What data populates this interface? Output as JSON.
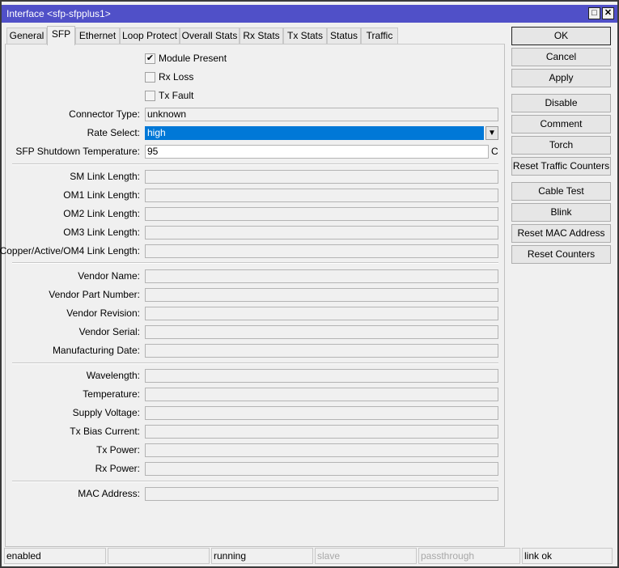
{
  "window": {
    "title": "Interface <sfp-sfpplus1>",
    "maximize_icon": "□",
    "close_icon": "✕"
  },
  "tabs": [
    "General",
    "SFP",
    "Ethernet",
    "Loop Protect",
    "Overall Stats",
    "Rx Stats",
    "Tx Stats",
    "Status",
    "Traffic"
  ],
  "active_tab": "SFP",
  "checkboxes": [
    {
      "label": "Module Present",
      "checked": true
    },
    {
      "label": "Rx Loss",
      "checked": false
    },
    {
      "label": "Tx Fault",
      "checked": false
    }
  ],
  "fields": {
    "connector_type": {
      "label": "Connector Type:",
      "value": "unknown"
    },
    "rate_select": {
      "label": "Rate Select:",
      "value": "high"
    },
    "shutdown_temp": {
      "label": "SFP Shutdown Temperature:",
      "value": "95",
      "unit": "C"
    }
  },
  "groups": [
    [
      {
        "label": "SM Link Length:",
        "value": ""
      },
      {
        "label": "OM1 Link Length:",
        "value": ""
      },
      {
        "label": "OM2 Link Length:",
        "value": ""
      },
      {
        "label": "OM3 Link Length:",
        "value": ""
      },
      {
        "label": "Copper/Active/OM4 Link Length:",
        "value": ""
      }
    ],
    [
      {
        "label": "Vendor Name:",
        "value": ""
      },
      {
        "label": "Vendor Part Number:",
        "value": ""
      },
      {
        "label": "Vendor Revision:",
        "value": ""
      },
      {
        "label": "Vendor Serial:",
        "value": ""
      },
      {
        "label": "Manufacturing Date:",
        "value": ""
      }
    ],
    [
      {
        "label": "Wavelength:",
        "value": ""
      },
      {
        "label": "Temperature:",
        "value": ""
      },
      {
        "label": "Supply Voltage:",
        "value": ""
      },
      {
        "label": "Tx Bias Current:",
        "value": ""
      },
      {
        "label": "Tx Power:",
        "value": ""
      },
      {
        "label": "Rx Power:",
        "value": ""
      }
    ],
    [
      {
        "label": "MAC Address:",
        "value": ""
      }
    ]
  ],
  "buttons": [
    "OK",
    "Cancel",
    "Apply",
    "Disable",
    "Comment",
    "Torch",
    "Reset Traffic Counters",
    "Cable Test",
    "Blink",
    "Reset MAC Address",
    "Reset Counters"
  ],
  "status_bar": [
    {
      "text": "enabled",
      "dim": false
    },
    {
      "text": "",
      "dim": false
    },
    {
      "text": "running",
      "dim": false
    },
    {
      "text": "slave",
      "dim": true
    },
    {
      "text": "passthrough",
      "dim": true
    },
    {
      "text": "link ok",
      "dim": false
    }
  ],
  "colors": {
    "titlebar": "#5050c8",
    "selection": "#0078d7"
  }
}
